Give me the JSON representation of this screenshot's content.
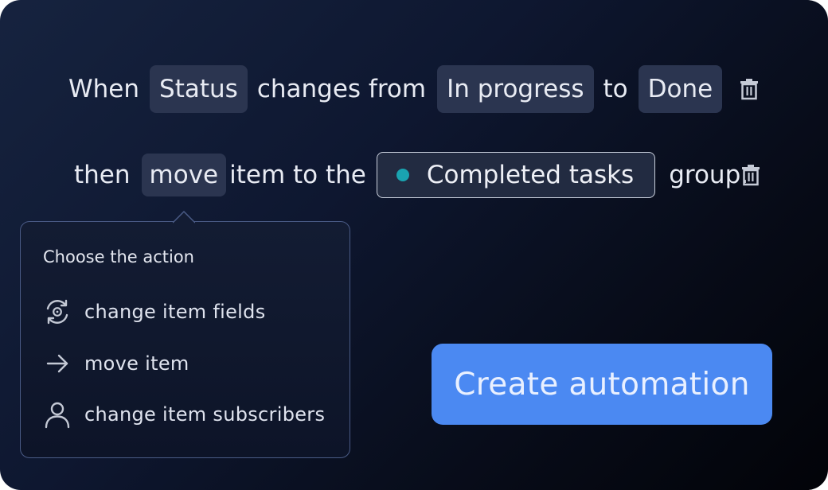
{
  "rule": {
    "when_label": "When",
    "field_chip": "Status",
    "changes_from_label": "changes from",
    "from_chip": "In progress",
    "to_label": "to",
    "to_chip": "Done"
  },
  "action": {
    "then_label": "then",
    "action_chip": "move",
    "item_to_the_label": "item to the",
    "group_value": "Completed tasks",
    "group_dot_color": "#1aa3b0",
    "group_suffix": "group."
  },
  "popover": {
    "title": "Choose the action",
    "items": [
      {
        "label": "change item fields",
        "icon": "sync-settings-icon"
      },
      {
        "label": "move item",
        "icon": "arrow-right-icon"
      },
      {
        "label": "change item subscribers",
        "icon": "user-icon"
      }
    ]
  },
  "cta": {
    "label": "Create automation",
    "color": "#4b89f2"
  },
  "icons": {
    "delete": "trash-icon"
  }
}
